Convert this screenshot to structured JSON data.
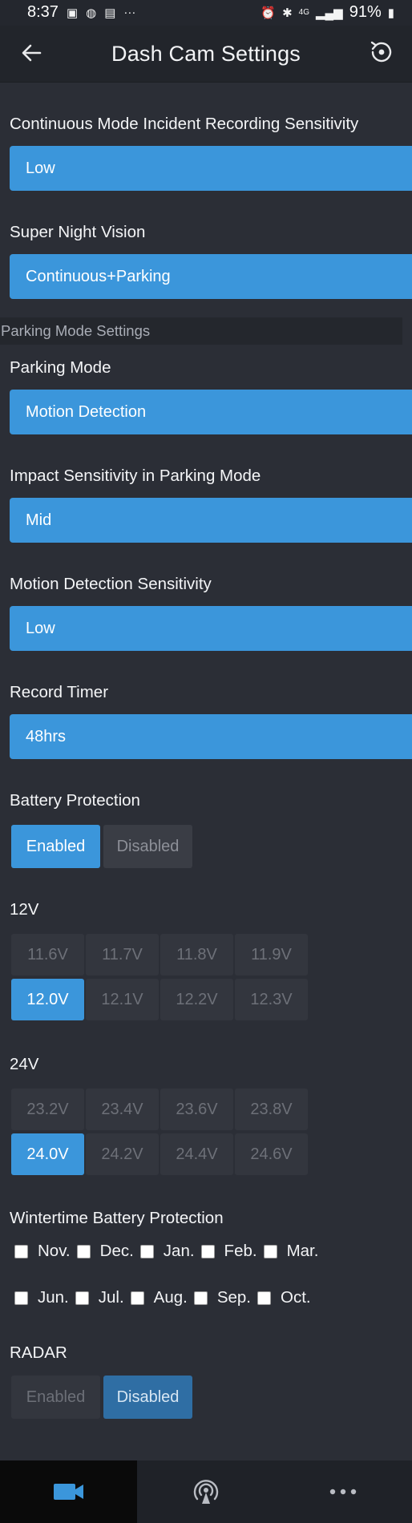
{
  "status_bar": {
    "time": "8:37",
    "battery": "91%",
    "icons_left": [
      "image-icon",
      "whatsapp-icon",
      "bag-icon",
      "more-dots-icon"
    ],
    "icons_right": [
      "alarm-icon",
      "bluetooth-icon",
      "4g-icon",
      "signal-icon",
      "battery-icon"
    ],
    "net_label": "4G"
  },
  "app_bar": {
    "title": "Dash Cam Settings"
  },
  "settings": {
    "continuous_sensitivity": {
      "label": "Continuous Mode Incident Recording Sensitivity",
      "value": "Low"
    },
    "super_night_vision": {
      "label": "Super Night Vision",
      "value": "Continuous+Parking"
    },
    "parking_header": "Parking Mode Settings",
    "parking_mode": {
      "label": "Parking Mode",
      "value": "Motion Detection"
    },
    "impact_sensitivity": {
      "label": "Impact Sensitivity in Parking Mode",
      "value": "Mid"
    },
    "motion_sensitivity": {
      "label": "Motion Detection Sensitivity",
      "value": "Low"
    },
    "record_timer": {
      "label": "Record Timer",
      "value": "48hrs"
    },
    "battery_protection": {
      "label": "Battery Protection",
      "options": [
        "Enabled",
        "Disabled"
      ],
      "selected": "Enabled"
    },
    "v12": {
      "label": "12V",
      "rows": [
        [
          "11.6V",
          "11.7V",
          "11.8V",
          "11.9V"
        ],
        [
          "12.0V",
          "12.1V",
          "12.2V",
          "12.3V"
        ]
      ],
      "selected": "12.0V"
    },
    "v24": {
      "label": "24V",
      "rows": [
        [
          "23.2V",
          "23.4V",
          "23.6V",
          "23.8V"
        ],
        [
          "24.0V",
          "24.2V",
          "24.4V",
          "24.6V"
        ]
      ],
      "selected": "24.0V"
    },
    "wintertime": {
      "label": "Wintertime Battery Protection",
      "months_row1": [
        "Nov.",
        "Dec.",
        "Jan.",
        "Feb.",
        "Mar."
      ],
      "months_row2": [
        "Jun.",
        "Jul.",
        "Aug.",
        "Sep.",
        "Oct."
      ]
    },
    "radar": {
      "label": "RADAR",
      "options": [
        "Enabled",
        "Disabled"
      ],
      "selected": "Disabled"
    }
  },
  "bottom_nav": {
    "tabs": [
      "camera-icon",
      "wifi-broadcast-icon",
      "more-horizontal-icon"
    ],
    "active": "camera-icon"
  },
  "colors": {
    "background": "#2b2e36",
    "accent": "#3b96db",
    "header_bg": "#22252b"
  }
}
